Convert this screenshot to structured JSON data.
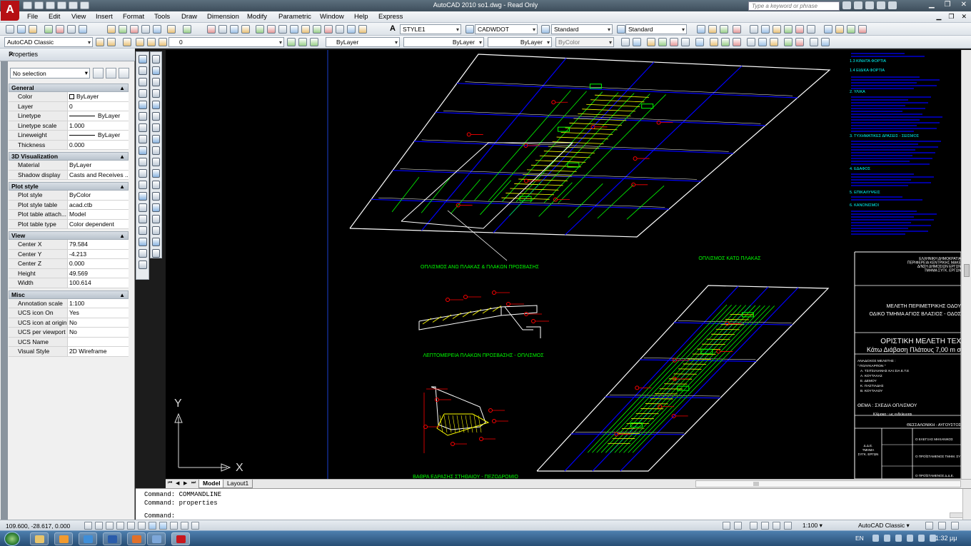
{
  "window": {
    "title": "AutoCAD 2010     so1.dwg - Read Only",
    "search_placeholder": "Type a keyword or phrase",
    "app_logo": "A"
  },
  "menus": [
    "File",
    "Edit",
    "View",
    "Insert",
    "Format",
    "Tools",
    "Draw",
    "Dimension",
    "Modify",
    "Parametric",
    "Window",
    "Help",
    "Express"
  ],
  "toolbar1": {
    "text_style_icon": "A",
    "text_style": "STYLE1",
    "dim_style": "CADWDOT",
    "table_style": "Standard",
    "multileader_style": "Standard"
  },
  "toolbar2": {
    "workspace": "AutoCAD Classic",
    "layer": "0",
    "color": "ByLayer",
    "linetype": "ByLayer",
    "lineweight": "ByLayer",
    "plot_style": "ByColor"
  },
  "properties": {
    "title": "Properties",
    "close": "✕",
    "selection": "No selection",
    "sections": [
      {
        "name": "General",
        "rows": [
          {
            "label": "Color",
            "value": "ByLayer",
            "swatch": "#ffffff"
          },
          {
            "label": "Layer",
            "value": "0"
          },
          {
            "label": "Linetype",
            "value": "ByLayer",
            "line": true
          },
          {
            "label": "Linetype scale",
            "value": "1.000"
          },
          {
            "label": "Lineweight",
            "value": "ByLayer",
            "line": true
          },
          {
            "label": "Thickness",
            "value": "0.000"
          }
        ]
      },
      {
        "name": "3D Visualization",
        "rows": [
          {
            "label": "Material",
            "value": "ByLayer"
          },
          {
            "label": "Shadow display",
            "value": "Casts and Receives ..."
          }
        ]
      },
      {
        "name": "Plot style",
        "rows": [
          {
            "label": "Plot style",
            "value": "ByColor"
          },
          {
            "label": "Plot style table",
            "value": "acad.ctb"
          },
          {
            "label": "Plot table attach...",
            "value": "Model"
          },
          {
            "label": "Plot table type",
            "value": "Color dependent"
          }
        ]
      },
      {
        "name": "View",
        "rows": [
          {
            "label": "Center X",
            "value": "79.584"
          },
          {
            "label": "Center Y",
            "value": "-4.213"
          },
          {
            "label": "Center Z",
            "value": "0.000"
          },
          {
            "label": "Height",
            "value": "49.569"
          },
          {
            "label": "Width",
            "value": "100.614"
          }
        ]
      },
      {
        "name": "Misc",
        "rows": [
          {
            "label": "Annotation scale",
            "value": "1:100"
          },
          {
            "label": "UCS icon On",
            "value": "Yes"
          },
          {
            "label": "UCS icon at origin",
            "value": "No"
          },
          {
            "label": "UCS per viewport",
            "value": "No"
          },
          {
            "label": "UCS Name",
            "value": ""
          },
          {
            "label": "Visual Style",
            "value": "2D Wireframe"
          }
        ]
      }
    ]
  },
  "drawing": {
    "titles": [
      "ΟΠΛΙΣΜΟΣ ΑΝΩ ΠΛΑΚΑΣ & ΠΛΑΚΩΝ ΠΡΟΣΒΑΣΗΣ",
      "ΟΠΛΙΣΜΟΣ ΚΑΤΩ ΠΛΑΚΑΣ",
      "ΛΕΠΤΟΜΕΡΕΙΑ ΠΛΑΚΩΝ ΠΡΟΣΒΑΣΗΣ - ΟΠΛΙΣΜΟΣ",
      "ΒΑΘΡΑ ΕΔΡΑΣΗΣ ΣΤΗΘΑΙΟΥ - ΠΕΖΟΔΡΟΜΙΟ"
    ],
    "notes": [
      "1.3 ΚΙΝΗΤΑ ΦΟΡΤΙΑ",
      "1.4 ΕΙΔΙΚΑ ΦΟΡΤΙΑ",
      "2. ΥΛΙΚΑ",
      "3. ΤΥΧΗΜΑΤΙΚΕΣ ΔΡΑΣΕΙΣ - ΣΕΙΣΜΟΣ",
      "4. ΕΔΑΦΟΣ",
      "5. ΕΠΙΚΑΛΥΨΕΙΣ",
      "6. ΚΑΝΟΝΙΣΜΟΙ"
    ],
    "title_block": {
      "authority": [
        "ΕΛΛΗΝΙΚΗ ΔΗΜΟΚΡΑΤΙΑ",
        "ΠΕΡΙΦΕΡΕΙΑ ΚΕΝΤΡΙΚΗΣ ΜΑΚΕ",
        "Δ/ΝΣΗ ΔΗΜΟΣΙΩΝ ΕΡΓΩΝ",
        "ΤΜΗΜΑ ΣΥΓΚ. ΕΡΓΩΝ"
      ],
      "project": [
        "ΜΕΛΕΤΗ ΠΕΡΙΜΕΤΡΙΚΗΣ ΟΔΟΥ",
        "ΟΔΙΚΟ ΤΜΗΜΑ ΑΓΙΟΣ ΒΛΑΣΙΟΣ - ΟΔΟΣ"
      ],
      "study": [
        "ΟΡΙΣΤΙΚΗ ΜΕΛΕΤΗ ΤΕΧ",
        "Κάτω Διάβαση Πλάτους 7,00 m σ"
      ],
      "authors": [
        "ΑΝΑΔΟΧΟΣ ΜΕΛΕΤΗΣ :",
        "\" ΠΟΛΥΚΑΡΠΟΝ \"",
        "Α. ΤΣΙΤΣΙΛΙΑΝΗΣ ΚΑΙ ΣΙΑ Ε.Τ.Ε",
        "Α. ΚΟΥΤΑΛΑΣ",
        "Ε. ΔΕΜΟΥ",
        "Κ. ΠΑΣΤΙΑΔΗΣ",
        "Β. ΚΟΥΤΑΛΟΥ"
      ],
      "subject": "ΘΕΜΑ :   ΣΧΕΔΙΑ ΟΠΛΙΣΜΟΥ",
      "scale": "Κλίμακα : ως ενδείκνυται",
      "place": "ΘΕΣΣΑΛΟΝΙΚΗ - ΑΥΓΟΥΣΤΟΣ",
      "dept": [
        "Δ.Δ.Ε.",
        "ΤΜΗΜΑ",
        "ΣΥΓΚ. ΕΡΓΩΝ"
      ],
      "sign": [
        "Ο ΕΛΕΓΞΑΣ ΜΗΧΑΝΙΚΟΣ",
        "Ο ΠΡΟΪΣΤΑΜΕΝΟΣ ΤΜΗΜ. ΣΥΓΚ. ΕΡΓΩΝ",
        "Ο ΠΡΟΪΣΤΑΜΕΝΟΣ Δ.Δ.Ε."
      ]
    },
    "ucs": {
      "y": "Y",
      "x": "X"
    }
  },
  "tabs": {
    "model": "Model",
    "layout": "Layout1"
  },
  "command": {
    "history": [
      "Command: COMMANDLINE",
      "Command: properties"
    ],
    "prompt": "Command:"
  },
  "status": {
    "coords": "109.600, -28.617, 0.000",
    "annotation_scale": "1:100 ▾",
    "workspace": "AutoCAD Classic ▾"
  },
  "taskbar": {
    "lang": "EN",
    "clock": "1:32 μμ"
  },
  "colors": {
    "red": "#ff0000",
    "green": "#00ff00",
    "blue": "#0000ff",
    "white": "#ffffff",
    "cyan": "#00ffff",
    "yellow": "#ffff00"
  }
}
